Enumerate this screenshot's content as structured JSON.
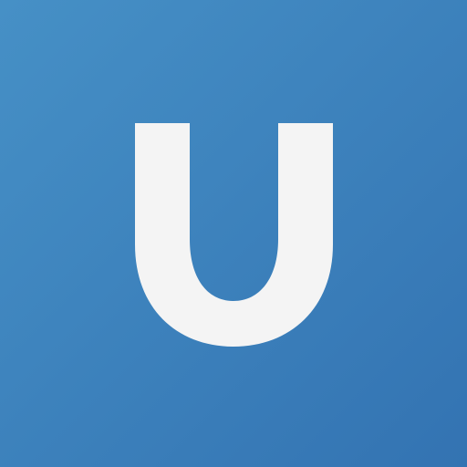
{
  "app_icon": {
    "letter": "U",
    "background_color_start": "#4690c6",
    "background_color_end": "#3373b2",
    "letter_color": "#f4f4f4"
  }
}
